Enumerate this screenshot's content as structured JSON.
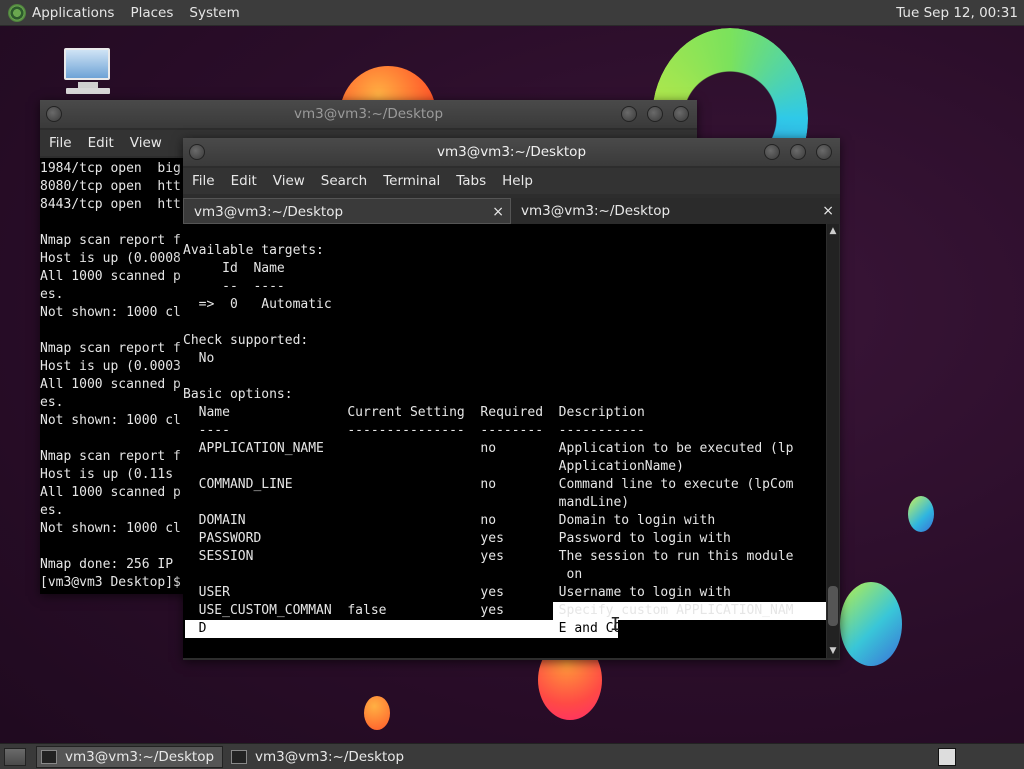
{
  "top_panel": {
    "menus": [
      "Applications",
      "Places",
      "System"
    ],
    "clock": "Tue Sep 12, 00:31"
  },
  "back_window": {
    "title": "vm3@vm3:~/Desktop",
    "menus": [
      "File",
      "Edit",
      "View"
    ],
    "lines": [
      "1984/tcp open  big",
      "8080/tcp open  htt",
      "8443/tcp open  htt",
      "",
      "Nmap scan report f",
      "Host is up (0.0008",
      "All 1000 scanned p",
      "es.",
      "Not shown: 1000 cl",
      "",
      "Nmap scan report f",
      "Host is up (0.0003",
      "All 1000 scanned p",
      "es.",
      "Not shown: 1000 cl",
      "",
      "Nmap scan report f",
      "Host is up (0.11s",
      "All 1000 scanned p",
      "es.",
      "Not shown: 1000 cl",
      "",
      "Nmap done: 256 IP",
      "[vm3@vm3 Desktop]$"
    ]
  },
  "front_window": {
    "title": "vm3@vm3:~/Desktop",
    "menus": [
      "File",
      "Edit",
      "View",
      "Search",
      "Terminal",
      "Tabs",
      "Help"
    ],
    "tabs": [
      {
        "label": "vm3@vm3:~/Desktop",
        "close": "×"
      },
      {
        "label": "vm3@vm3:~/Desktop",
        "close": "×"
      }
    ],
    "lines": [
      "Available targets:",
      "     Id  Name",
      "     --  ----",
      "  =>  0   Automatic",
      "",
      "Check supported:",
      "  No",
      "",
      "Basic options:",
      "  Name               Current Setting  Required  Description",
      "  ----               ---------------  --------  -----------",
      "  APPLICATION_NAME                    no        Application to be executed (lp",
      "                                                ApplicationName)",
      "  COMMAND_LINE                        no        Command line to execute (lpCom",
      "                                                mandLine)",
      "  DOMAIN                              no        Domain to login with",
      "  PASSWORD                            yes       Password to login with",
      "  SESSION                             yes       The session to run this module",
      "                                                 on",
      "  USER                                yes       Username to login with",
      "  USE_CUSTOM_COMMAN  false            yes       Specify custom APPLICATION_NAM",
      "  D                                             E and COMMAND_LINE"
    ]
  },
  "taskbar": {
    "tasks": [
      "vm3@vm3:~/Desktop",
      "vm3@vm3:~/Desktop"
    ]
  },
  "colors": {
    "terminal_bg": "#000000",
    "terminal_fg": "#e6e6e6",
    "panel_bg": "#3c3c3c",
    "desktop_bg": "#2b0f2a"
  }
}
